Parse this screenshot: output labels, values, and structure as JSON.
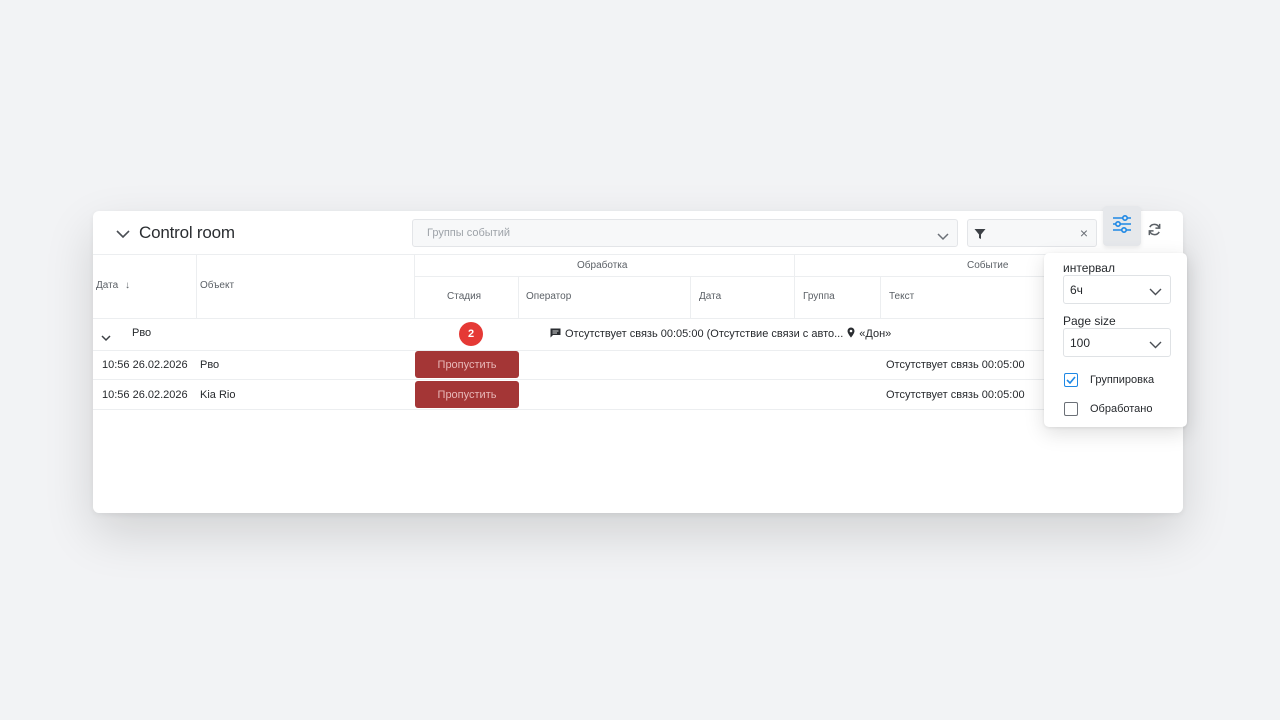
{
  "header": {
    "title": "Control room",
    "group_placeholder": "Группы событий",
    "filter_value": "",
    "clear_glyph": "×"
  },
  "columns": {
    "date": "Дата",
    "object": "Объект",
    "processing": "Обработка",
    "event": "Событие",
    "stage": "Стадия",
    "operator": "Оператор",
    "proc_date": "Дата",
    "group": "Группа",
    "text": "Текст",
    "sort_indicator": "↓"
  },
  "group_row": {
    "name": "Рво",
    "count": "2",
    "message": "Отсутствует связь 00:05:00 (Отсутствие связи с авто...",
    "location": "«Дон»"
  },
  "rows": [
    {
      "date": "10:56 26.02.2026",
      "object": "Рво",
      "action": "Пропустить",
      "text": "Отсутствует связь 00:05:00"
    },
    {
      "date": "10:56 26.02.2026",
      "object": "Kia Rio",
      "action": "Пропустить",
      "text": "Отсутствует связь 00:05:00"
    }
  ],
  "settings": {
    "interval_label": "интервал",
    "interval_value": "6ч",
    "page_size_label": "Page size",
    "page_size_value": "100",
    "grouping_label": "Группировка",
    "grouping_checked": true,
    "processed_label": "Обработано",
    "processed_checked": false
  },
  "colors": {
    "accent": "#1e88e5",
    "badge": "#e53935",
    "skip_button": "#a43636"
  }
}
